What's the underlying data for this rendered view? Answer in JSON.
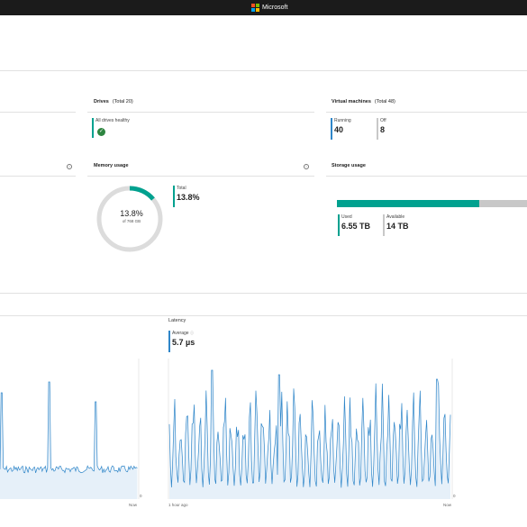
{
  "topbar": {
    "brand": "Microsoft",
    "logo_colors": [
      "#f25022",
      "#7fba00",
      "#00a4ef",
      "#ffb900"
    ]
  },
  "drives": {
    "title": "Drives",
    "total": "(Total 20)",
    "status_label": "All drives healthy",
    "status_color": "#2e8540"
  },
  "vms": {
    "title": "Virtual machines",
    "total": "(Total 48)",
    "running_label": "Running",
    "running_value": "40",
    "off_label": "Off",
    "off_value": "8"
  },
  "memory": {
    "title": "Memory usage",
    "center_value": "13.8%",
    "center_sub": "of 768 GB",
    "total_label": "Total",
    "total_value": "13.8%",
    "usage_fraction": 0.138,
    "accent": "#00a18f"
  },
  "storage": {
    "title": "Storage usage",
    "used_label": "Used",
    "used_value": "6.55 TB",
    "available_label": "Available",
    "available_value": "14 TB",
    "used_fraction": 0.75,
    "accent": "#00a18f"
  },
  "latency": {
    "title": "Latency",
    "average_label": "Average",
    "average_value": "5.7 µs",
    "x_start": "1 hour ago",
    "x_end": "Now",
    "y_min": "0"
  },
  "left_chart": {
    "x_end": "Now",
    "y_min": "0"
  },
  "colors": {
    "line": "#2f86c9",
    "fill": "#e6f0f9",
    "metric_bar_blue": "#2f86c9",
    "metric_bar_teal": "#00a18f",
    "metric_bar_gray": "#c8c8c8"
  }
}
